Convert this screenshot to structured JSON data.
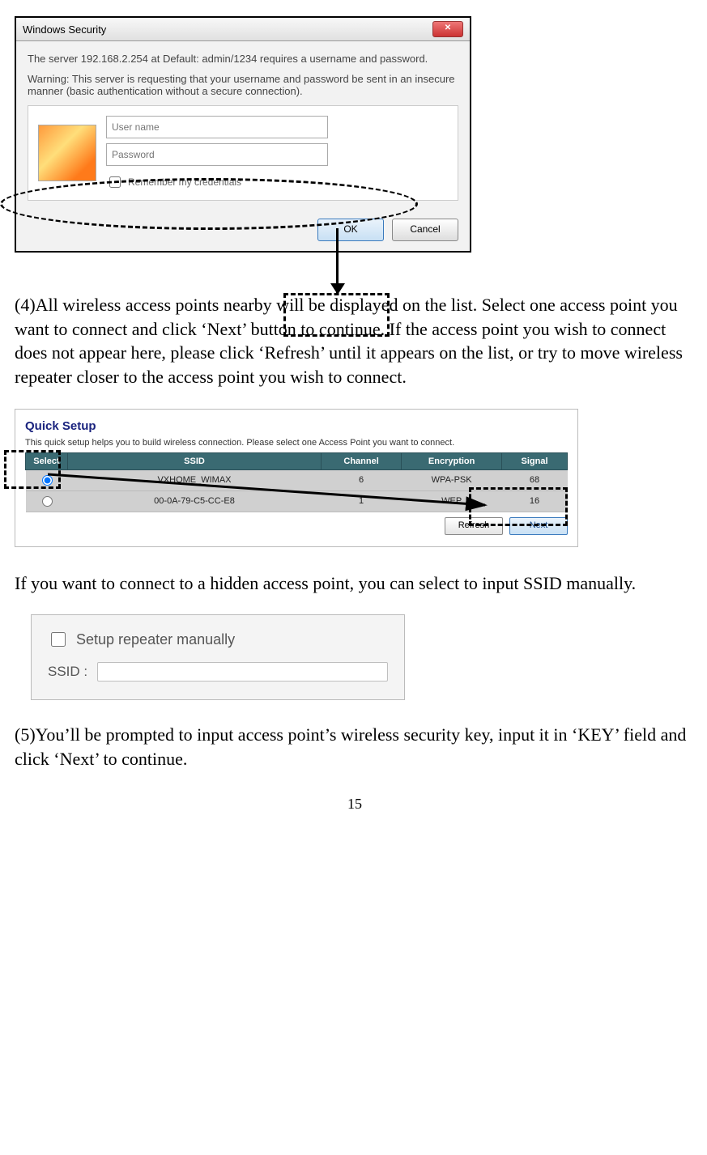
{
  "dialog": {
    "title": "Windows Security",
    "line1": "The server 192.168.2.254 at Default: admin/1234 requires a username and password.",
    "line2": "Warning: This server is requesting that your username and password be sent in an insecure manner (basic authentication without a secure connection).",
    "username_placeholder": "User name",
    "password_placeholder": "Password",
    "remember_label": "Remember my credentials",
    "ok_label": "OK",
    "cancel_label": "Cancel"
  },
  "para4": "(4)All wireless access points nearby will be displayed on the list. Select one access point you want to connect and click ‘Next’ button to continue. If the access point you wish to connect does not appear here, please click ‘Refresh’ until it appears on the list, or try to move wireless repeater closer to the access point you wish to connect.",
  "setup": {
    "title": "Quick Setup",
    "desc": "This quick setup helps you to build wireless connection. Please select one Access Point you want to connect.",
    "headers": {
      "select": "Select",
      "ssid": "SSID",
      "channel": "Channel",
      "encryption": "Encryption",
      "signal": "Signal"
    },
    "rows": [
      {
        "ssid": "VXHOME_WIMAX",
        "channel": "6",
        "encryption": "WPA-PSK",
        "signal": "68"
      },
      {
        "ssid": "00-0A-79-C5-CC-E8",
        "channel": "1",
        "encryption": "WEP",
        "signal": "16"
      }
    ],
    "refresh_label": "Refresh",
    "next_label": "Next"
  },
  "para_hidden": "If you want to connect to a hidden access point, you can select to input SSID manually.",
  "manual": {
    "checkbox_label": "Setup repeater manually",
    "ssid_label": "SSID :"
  },
  "para5": "(5)You’ll be prompted to input access point’s wireless security key, input it in ‘KEY’ field and click ‘Next’ to continue.",
  "page_number": "15"
}
